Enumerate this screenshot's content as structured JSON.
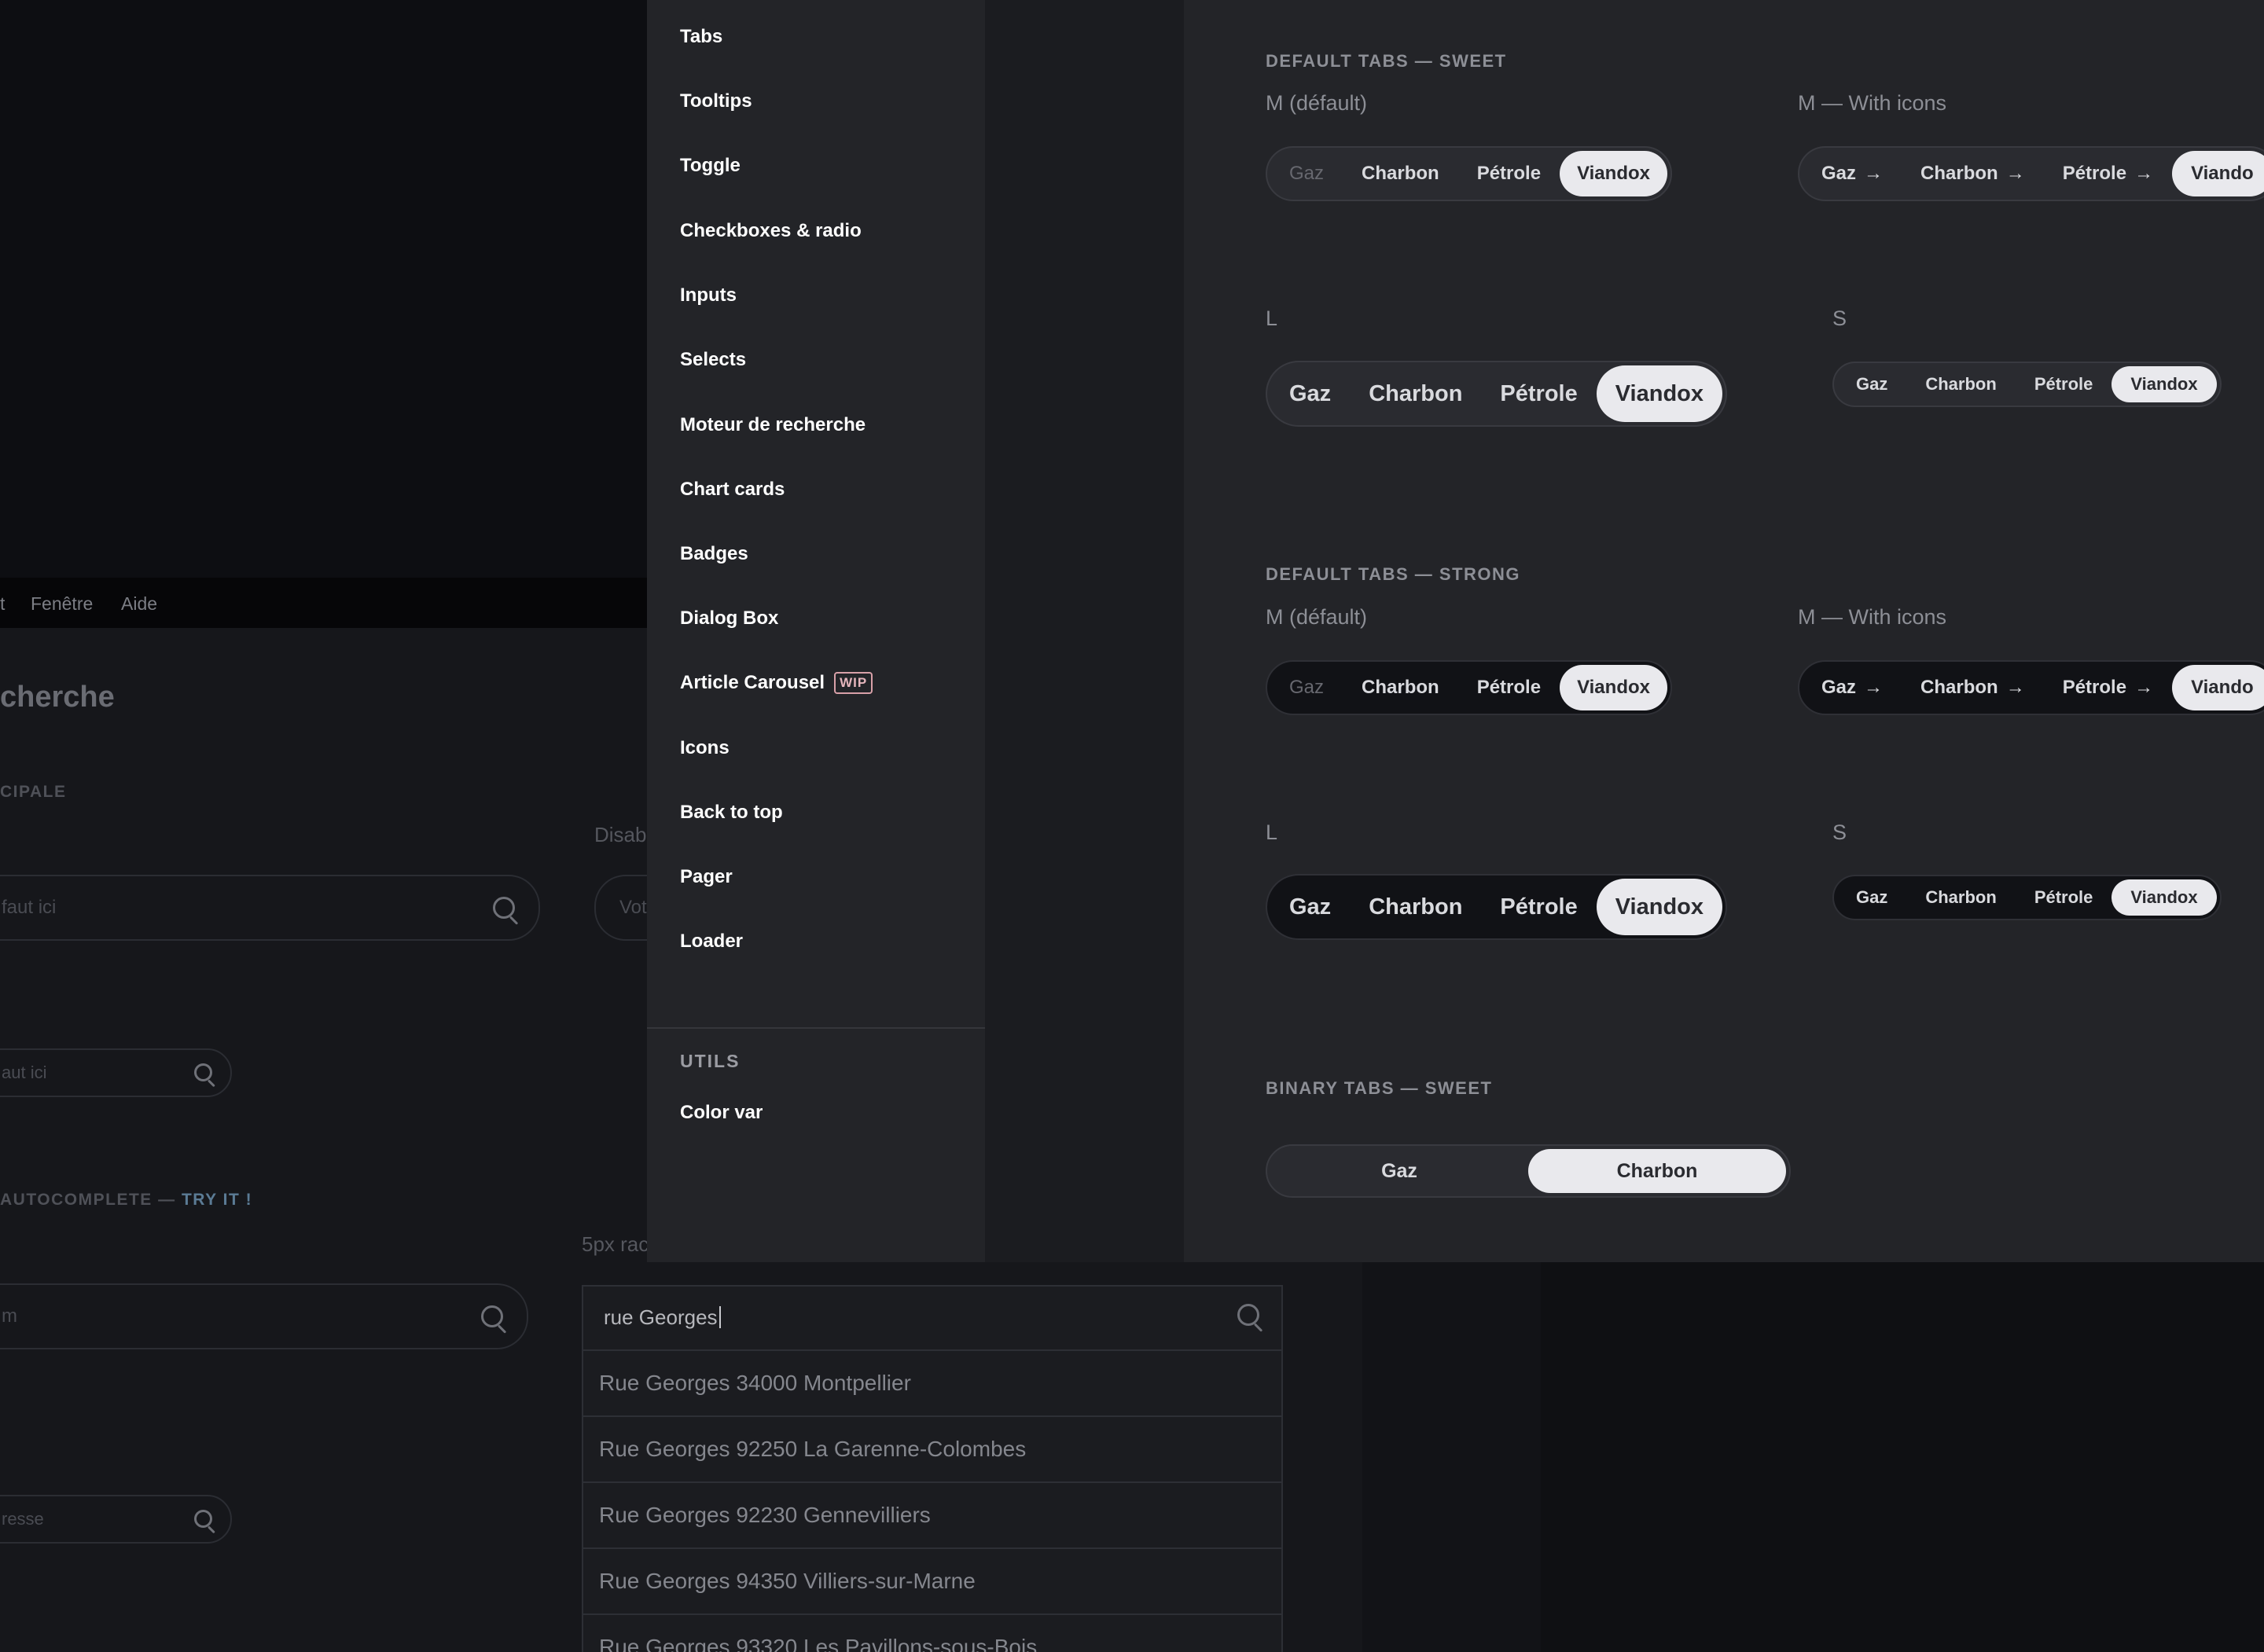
{
  "background_window": {
    "menubar": [
      "t",
      "Fenêtre",
      "Aide"
    ],
    "page_title": "cherche",
    "section_main": "CIPALE",
    "disabled_label": "Disab",
    "input_large_placeholder": "faut ici",
    "input_small_placeholder": "aut ici",
    "disabled_input_placeholder": "Vot",
    "autocomplete_section": "AUTOCOMPLETE — ",
    "autocomplete_try": "TRY IT !",
    "radius_label": "5px rac",
    "input3_placeholder": "m",
    "input4_placeholder": "resse",
    "autocomplete": {
      "value": "rue Georges",
      "results": [
        "Rue Georges 34000 Montpellier",
        "Rue Georges 92250 La Garenne-Colombes",
        "Rue Georges 92230 Gennevilliers",
        "Rue Georges 94350 Villiers-sur-Marne",
        "Rue Georges 93320 Les Pavillons-sous-Bois"
      ]
    }
  },
  "sidebar": {
    "items": [
      "Tabs",
      "Tooltips",
      "Toggle",
      "Checkboxes & radio",
      "Inputs",
      "Selects",
      "Moteur de recherche",
      "Chart cards",
      "Badges",
      "Dialog Box",
      "Article Carousel",
      "Icons",
      "Back to top",
      "Pager",
      "Loader"
    ],
    "wip_badge": "WIP",
    "utils_title": "UTILS",
    "utils_items": [
      "Color var"
    ]
  },
  "main": {
    "sweet_title": "DEFAULT TABS — SWEET",
    "strong_title": "DEFAULT TABS — STRONG",
    "binary_title": "BINARY TABS — SWEET",
    "label_m": "M (défault)",
    "label_m_icons": "M — With icons",
    "label_l": "L",
    "label_s": "S",
    "tabs": [
      "Gaz",
      "Charbon",
      "Pétrole",
      "Viandox"
    ],
    "tabs_icons_visible": [
      "Gaz",
      "Charbon",
      "Pétrole",
      "Viando"
    ],
    "arrow": "→",
    "binary_tabs": [
      "Gaz",
      "Charbon"
    ]
  },
  "colors": {
    "panel": "#232428",
    "active_tab": "#e9e9ed",
    "wip": "#d8a0a8",
    "try_link": "#5b7b95"
  }
}
